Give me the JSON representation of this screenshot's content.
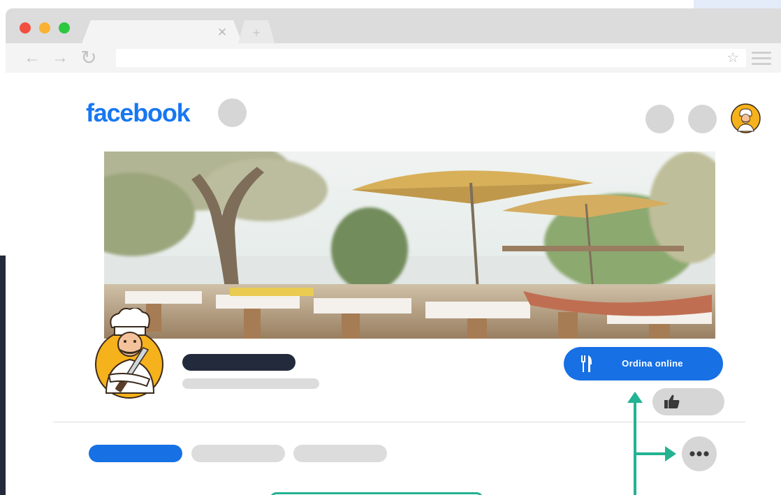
{
  "browser": {
    "tab_close": "×",
    "new_tab": "+",
    "back": "←",
    "forward": "→",
    "reload": "↻",
    "bookmark": "☆"
  },
  "page": {
    "logo": "facebook",
    "order_button_label": "Ordina online"
  },
  "icons": {
    "order": "fork-knife-icon",
    "like": "thumbs-up-icon",
    "more": "more-dots-icon",
    "avatar": "chef-mascot"
  },
  "colors": {
    "facebook_blue": "#1877f2",
    "button_blue": "#1770e4",
    "name_dark": "#232a3b",
    "placeholder_gray": "#d6d6d6",
    "arrow_green": "#23b392"
  }
}
